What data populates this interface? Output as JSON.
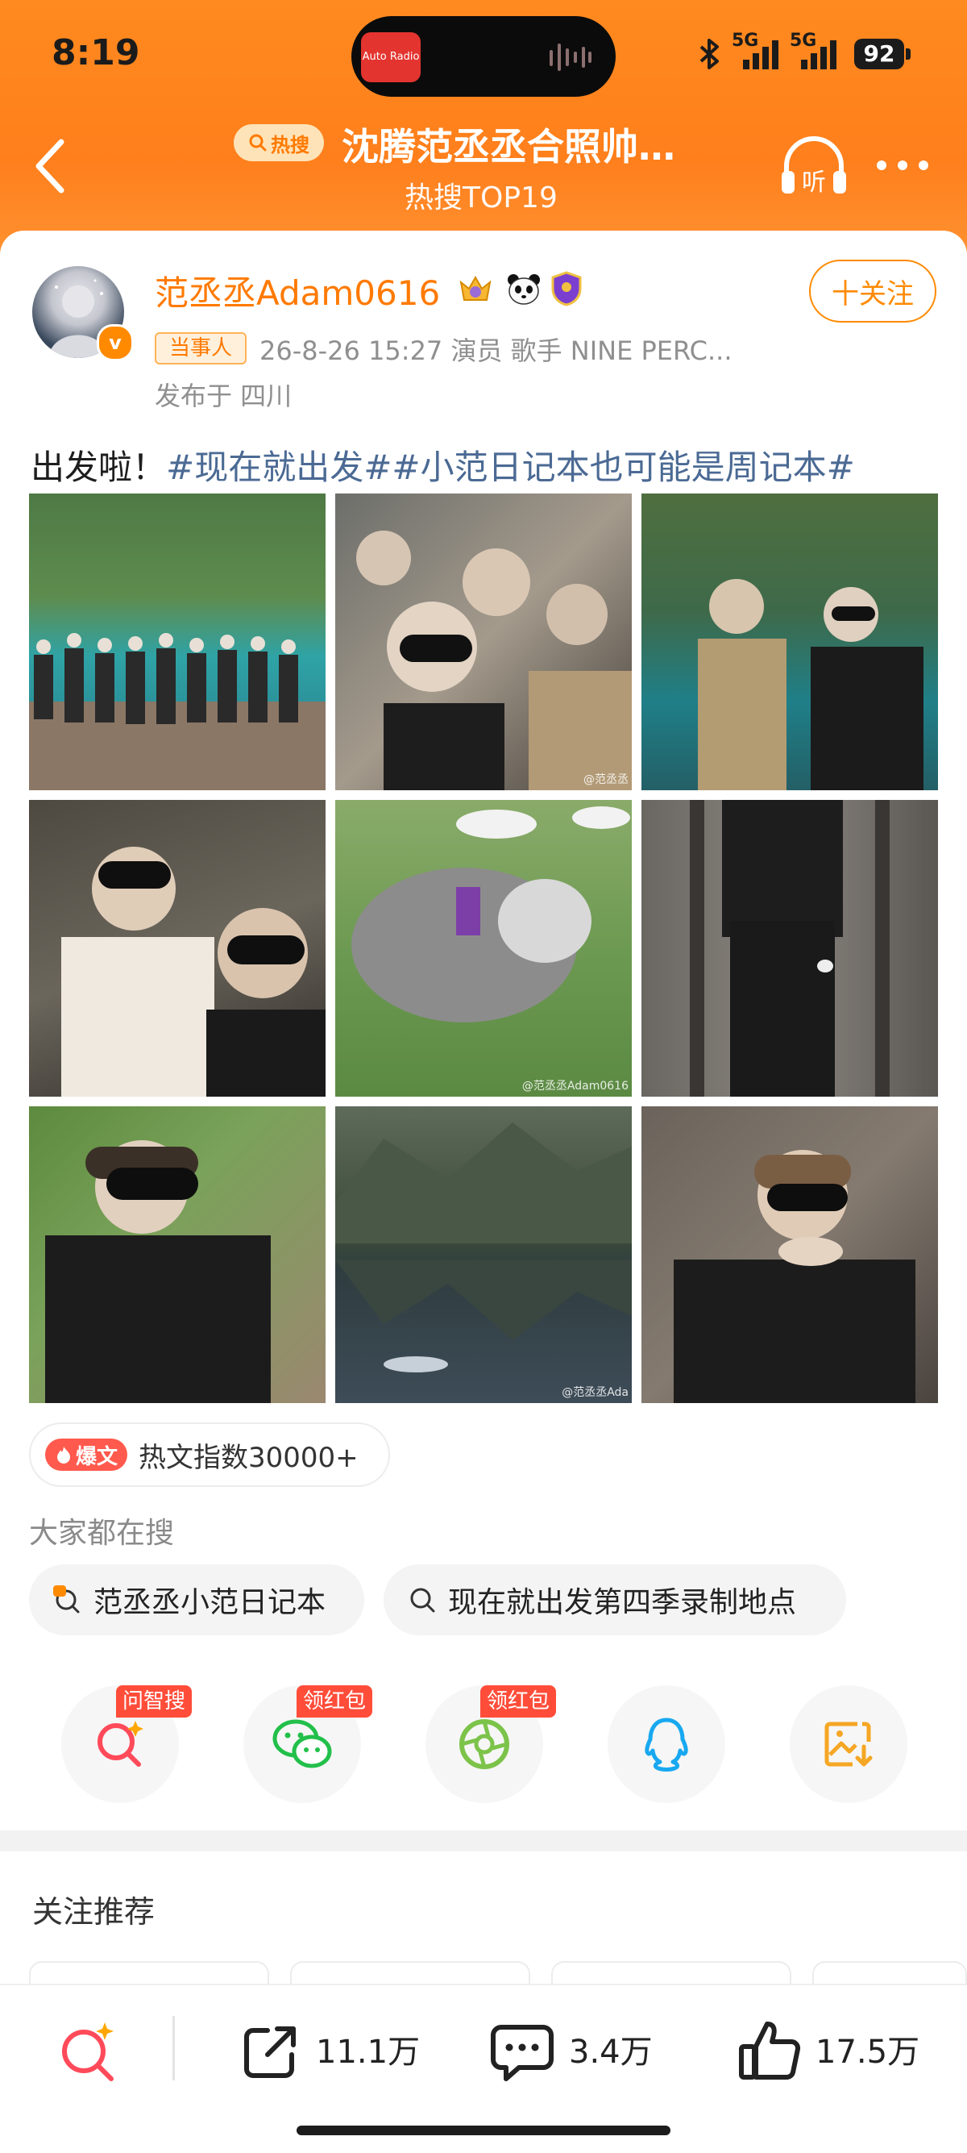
{
  "status_bar": {
    "time": "8:19",
    "island_app": "Auto Radio",
    "network_1": "5G",
    "network_2": "5G",
    "battery": "92"
  },
  "header": {
    "hot_badge": "热搜",
    "title": "沈腾范丞丞合照帅…",
    "subtitle": "热搜TOP19",
    "listen_label": "听"
  },
  "post": {
    "user_name": "范丞丞Adam0616",
    "verified_mark": "v",
    "follow_label": "十关注",
    "party_tag": "当事人",
    "meta": "26-8-26 15:27   演员 歌手 NINE PERC...",
    "location": "发布于 四川",
    "text_plain": "出发啦！",
    "text_tags": "#现在就出发##小范日记本也可能是周记本#",
    "watermarks": [
      "@范丞丞",
      "@范丞丞Adam0616",
      "@范丞丞Ada"
    ]
  },
  "hot_index": {
    "badge": "爆文",
    "text": "热文指数30000+"
  },
  "search": {
    "heading": "大家都在搜",
    "chips": [
      "范丞丞小范日记本",
      "现在就出发第四季录制地点"
    ]
  },
  "share": {
    "tags": [
      "问智搜",
      "领红包",
      "领红包"
    ]
  },
  "recommend": {
    "title": "关注推荐"
  },
  "bottom_bar": {
    "reposts": "11.1万",
    "comments": "3.4万",
    "likes": "17.5万"
  },
  "colors": {
    "brand_orange": "#ff8a1f",
    "accent": "#ff7a00",
    "topic_blue": "#4b6a94"
  }
}
